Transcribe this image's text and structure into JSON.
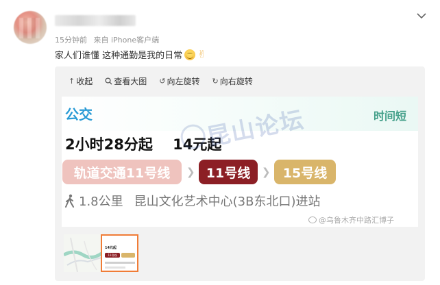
{
  "post": {
    "time": "15分钟前",
    "source": "来自 iPhone客户端",
    "text": "家人们谁懂 这种通勤是我的日常",
    "emojis": [
      "smile-emoji",
      "victory-hand-emoji"
    ]
  },
  "toolbar": {
    "collapse": "收起",
    "view_large": "查看大图",
    "rotate_left": "向左旋转",
    "rotate_right": "向右旋转"
  },
  "route_card": {
    "title": "公交",
    "tag": "时间短",
    "duration": "2小时28分起",
    "price": "14元起",
    "segments": [
      {
        "label": "轨道交通11号线",
        "color": "#efc3be"
      },
      {
        "label": "11号线",
        "color": "#8c1f25"
      },
      {
        "label": "15号线",
        "color": "#d9b56a"
      }
    ],
    "walk_distance": "1.8公里",
    "station": "昆山文化艺术中心(3B东北口)进站",
    "watermark": "昆山论坛",
    "weibo_watermark": "@乌鲁木齐中路汇博子"
  },
  "thumbnails": {
    "selected_price": "14元起",
    "selected_line": "11号线"
  },
  "colors": {
    "bus_title": "#2a9bd5",
    "short_tag": "#44a08a",
    "selected_border": "#f07c36"
  }
}
